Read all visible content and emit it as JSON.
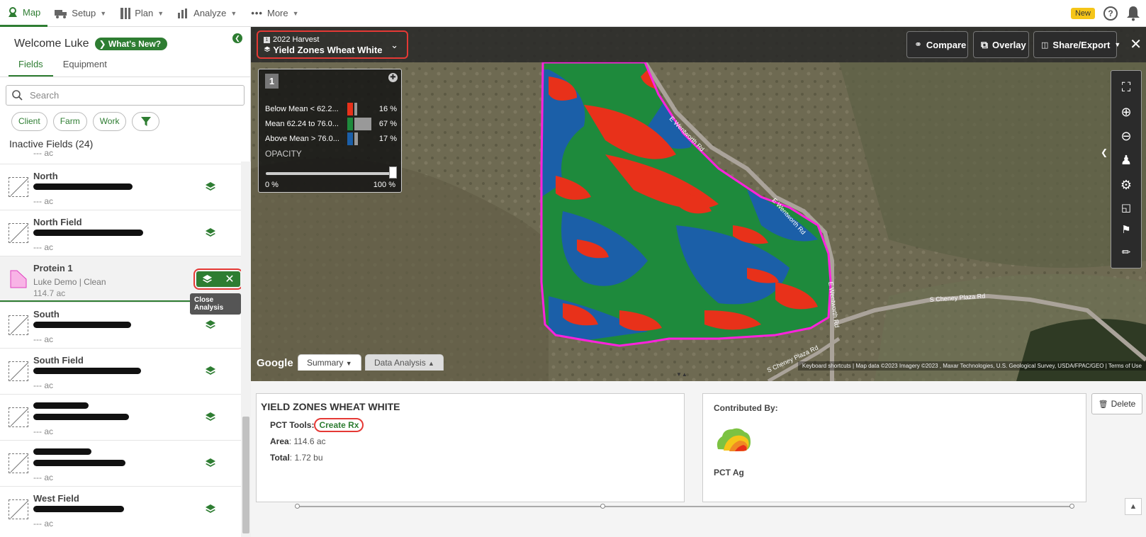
{
  "nav": {
    "items": [
      {
        "label": "Map",
        "icon": "map-pin-icon",
        "active": true
      },
      {
        "label": "Setup",
        "icon": "truck-icon"
      },
      {
        "label": "Plan",
        "icon": "columns-icon"
      },
      {
        "label": "Analyze",
        "icon": "bar-chart-icon"
      },
      {
        "label": "More",
        "icon": "dots-icon"
      }
    ],
    "new_badge": "New",
    "help": "?"
  },
  "sidebar": {
    "welcome": "Welcome Luke",
    "whats_new": "What's New?",
    "tabs": [
      "Fields",
      "Equipment"
    ],
    "search_placeholder": "Search",
    "chips": [
      "Client",
      "Farm",
      "Work"
    ],
    "section_title": "Inactive Fields (24)",
    "partial_acres": "--- ac",
    "fields": [
      {
        "name": "North",
        "acres": "--- ac"
      },
      {
        "name": "North Field",
        "acres": "--- ac"
      },
      {
        "name": "Protein 1",
        "meta": "Luke Demo | Clean",
        "acres": "114.7 ac"
      },
      {
        "name": "South",
        "acres": "--- ac"
      },
      {
        "name": "South Field",
        "acres": "--- ac"
      },
      {
        "name": "",
        "acres": "--- ac"
      },
      {
        "name": "",
        "acres": "--- ac"
      },
      {
        "name": "West Field",
        "acres": "--- ac"
      }
    ],
    "tooltip": "Close Analysis"
  },
  "map": {
    "layer_season": "2022 Harvest",
    "layer_index": "1",
    "layer_title": "Yield Zones Wheat White",
    "buttons": {
      "compare": "Compare",
      "overlay": "Overlay",
      "share": "Share/Export"
    },
    "legend": {
      "number": "1",
      "rows": [
        {
          "label": "Below Mean < 62.2...",
          "pct": "16 %",
          "color": "#e8311a",
          "share": 16
        },
        {
          "label": "Mean 62.24 to 76.0...",
          "pct": "67 %",
          "color": "#1e8a3c",
          "share": 67
        },
        {
          "label": "Above Mean > 76.0...",
          "pct": "17 %",
          "color": "#1b5fa8",
          "share": 17
        }
      ],
      "opacity_label": "OPACITY",
      "opacity_min": "0 %",
      "opacity_max": "100 %",
      "opacity_value": 1.0
    },
    "road_labels": [
      "E Wentworth Rd",
      "E Wentworth Rd",
      "E Wentworth Rd",
      "S Cheney Plaza Rd",
      "S Cheney Plaza Rd"
    ],
    "google": "Google",
    "tabs": {
      "summary": "Summary",
      "data_analysis": "Data Analysis"
    },
    "attribution": "Keyboard shortcuts | Map data ©2023 Imagery ©2023 , Maxar Technologies, U.S. Geological Survey, USDA/FPAC/GEO | Terms of Use"
  },
  "details": {
    "title": "YIELD ZONES WHEAT WHITE",
    "pct_tools_label": "PCT Tools:",
    "create_rx": "Create Rx",
    "area_label": "Area",
    "area_value": ": 114.6 ac",
    "total_label": "Total",
    "total_value": ": 1.72 bu",
    "contributed_label": "Contributed By:",
    "contributor": "PCT Ag",
    "delete": "Delete"
  }
}
